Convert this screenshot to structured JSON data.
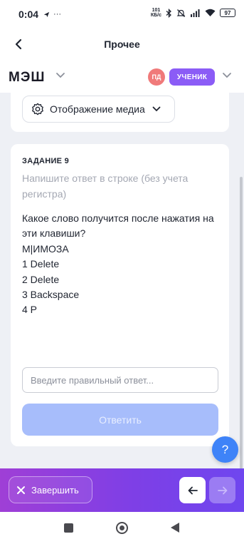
{
  "status_bar": {
    "time": "0:04",
    "net_speed_value": "101",
    "net_speed_unit": "КБ/с",
    "battery": "97",
    "icons": [
      "location-icon",
      "dots-icon",
      "bluetooth-icon",
      "mute-icon",
      "signal-icon",
      "wifi-icon",
      "battery-icon"
    ]
  },
  "topbar": {
    "title": "Прочее"
  },
  "brand": {
    "logo": "МЭШ",
    "avatar_initials": "ПД",
    "role": "УЧЕНИК"
  },
  "media": {
    "label": "Отображение медиа"
  },
  "task": {
    "label": "ЗАДАНИЕ 9",
    "hint": "Напишите ответ в строке (без учета регистра)",
    "question": "Какое слово получится после нажатия на эти клавиши?",
    "lines": [
      "М|ИМОЗА",
      "1 Delete",
      "2 Delete",
      "3 Backspace",
      "4 Р"
    ],
    "answer_value": "",
    "answer_placeholder": "Введите правильный ответ...",
    "submit_label": "Ответить"
  },
  "help": {
    "label": "?"
  },
  "bottom_bar": {
    "finish_label": "Завершить"
  },
  "colors": {
    "accent_purple": "#8b5cf6",
    "submit_disabled": "#a7bdfb",
    "help_blue": "#3e83f8",
    "avatar": "#f07a7a"
  }
}
